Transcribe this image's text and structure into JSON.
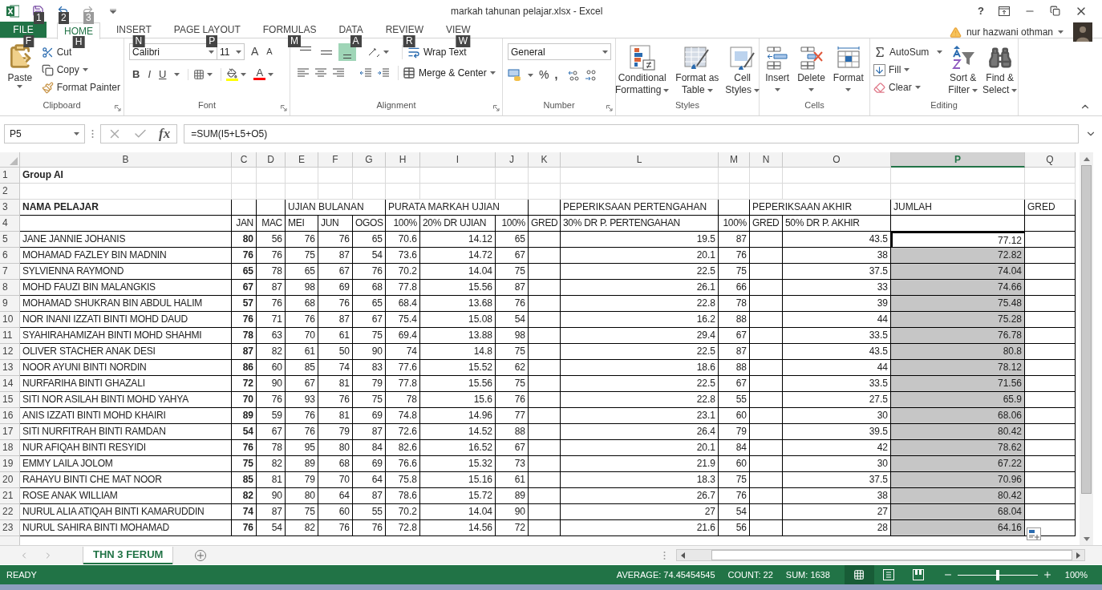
{
  "window": {
    "title": "markah tahunan pelajar.xlsx - Excel",
    "help": "?"
  },
  "quick_access": [
    {
      "kind": "save",
      "keytip": "1",
      "disabled": false
    },
    {
      "kind": "undo",
      "keytip": "2",
      "disabled": false
    },
    {
      "kind": "redo",
      "keytip": "3",
      "disabled": true
    }
  ],
  "tabs": [
    {
      "label": "FILE",
      "keytip": "F",
      "kind": "file",
      "selected": false
    },
    {
      "label": "HOME",
      "keytip": "H",
      "kind": "tab",
      "selected": true
    },
    {
      "label": "INSERT",
      "keytip": "N",
      "kind": "tab",
      "selected": false
    },
    {
      "label": "PAGE LAYOUT",
      "keytip": "P",
      "kind": "tab",
      "selected": false
    },
    {
      "label": "FORMULAS",
      "keytip": "M",
      "kind": "tab",
      "selected": false
    },
    {
      "label": "DATA",
      "keytip": "A",
      "kind": "tab",
      "selected": false
    },
    {
      "label": "REVIEW",
      "keytip": "R",
      "kind": "tab",
      "selected": false
    },
    {
      "label": "VIEW",
      "keytip": "W",
      "kind": "tab",
      "selected": false
    }
  ],
  "account": {
    "name": "nur hazwani othman"
  },
  "ribbon": {
    "clipboard": {
      "label": "Clipboard",
      "paste": "Paste",
      "cut": "Cut",
      "copy": "Copy",
      "format_painter": "Format Painter"
    },
    "font": {
      "label": "Font",
      "font_name": "Calibri",
      "font_size": "11",
      "grow": "A",
      "shrink": "A",
      "bold": "B",
      "italic": "I",
      "underline": "U",
      "font_color": "A"
    },
    "alignment": {
      "label": "Alignment",
      "vertical": [
        {
          "kind": "top",
          "selected": false
        },
        {
          "kind": "middle",
          "selected": false
        },
        {
          "kind": "bottom",
          "selected": true
        }
      ],
      "wrap_text": "Wrap Text",
      "merge_center": "Merge & Center"
    },
    "number": {
      "label": "Number",
      "format": "General",
      "percent": "%",
      "comma": ","
    },
    "styles": {
      "label": "Styles",
      "buttons": [
        {
          "kind": "conditional",
          "lines": [
            "Conditional",
            "Formatting"
          ]
        },
        {
          "kind": "table",
          "lines": [
            "Format as",
            "Table"
          ]
        },
        {
          "kind": "cell",
          "lines": [
            "Cell",
            "Styles"
          ]
        }
      ]
    },
    "cells": {
      "label": "Cells",
      "buttons": [
        {
          "kind": "insert",
          "label": "Insert"
        },
        {
          "kind": "delete",
          "label": "Delete"
        },
        {
          "kind": "format",
          "label": "Format"
        }
      ]
    },
    "editing": {
      "label": "Editing",
      "autosum": "AutoSum",
      "fill": "Fill",
      "clear": "Clear",
      "sort": [
        "Sort &",
        "Filter"
      ],
      "find": [
        "Find &",
        "Select"
      ]
    }
  },
  "formula_bar": {
    "name_box": "P5",
    "fx": "fx",
    "formula": "=SUM(I5+L5+O5)"
  },
  "sheet": {
    "columns": [
      {
        "letter": "B",
        "selected": false
      },
      {
        "letter": "C",
        "selected": false
      },
      {
        "letter": "D",
        "selected": false
      },
      {
        "letter": "E",
        "selected": false
      },
      {
        "letter": "F",
        "selected": false
      },
      {
        "letter": "G",
        "selected": false
      },
      {
        "letter": "H",
        "selected": false
      },
      {
        "letter": "I",
        "selected": false
      },
      {
        "letter": "J",
        "selected": false
      },
      {
        "letter": "K",
        "selected": false
      },
      {
        "letter": "L",
        "selected": false
      },
      {
        "letter": "M",
        "selected": false
      },
      {
        "letter": "N",
        "selected": false
      },
      {
        "letter": "O",
        "selected": false
      },
      {
        "letter": "P",
        "selected": true
      },
      {
        "letter": "Q",
        "selected": false
      }
    ],
    "title_row": {
      "number": "1",
      "text": "Group AI"
    },
    "blank_row": {
      "number": "2"
    },
    "header_row": {
      "number": "3",
      "name": "NAMA PELAJAR",
      "ujian_bulanan": "UJIAN BULANAN",
      "purata": "PURATA MARKAH UJIAN",
      "pertengahan": "PEPERIKSAAN PERTENGAHAN",
      "akhir": "PEPERIKSAAN AKHIR",
      "jumlah": "JUMLAH",
      "gred": "GRED"
    },
    "subheader_row": {
      "number": "4",
      "cells": [
        "JAN",
        "MAC",
        "MEI",
        "JUN",
        "OGOS",
        "100%",
        "20% DR UJIAN",
        "100%",
        "GRED",
        "30% DR P. PERTENGAHAN",
        "100%",
        "GRED",
        "50% DR P. AKHIR"
      ]
    },
    "rows": [
      {
        "number": "5",
        "name": "JANE JANNIE JOHANIS",
        "jan": "80",
        "mac": "56",
        "mei": "76",
        "jun": "76",
        "ogos": "65",
        "purata": "70.6",
        "ujian_20": "14.12",
        "pertengahan_100": "65",
        "pertengahan_30": "19.5",
        "akhir_100": "87",
        "akhir_50": "43.5",
        "jumlah": "77.12",
        "selected": false,
        "active": true
      },
      {
        "number": "6",
        "name": "MOHAMAD FAZLEY BIN MADNIN",
        "jan": "76",
        "mac": "76",
        "mei": "75",
        "jun": "87",
        "ogos": "54",
        "purata": "73.6",
        "ujian_20": "14.72",
        "pertengahan_100": "67",
        "pertengahan_30": "20.1",
        "akhir_100": "76",
        "akhir_50": "38",
        "jumlah": "72.82",
        "selected": true,
        "active": false
      },
      {
        "number": "7",
        "name": "SYLVIENNA RAYMOND",
        "jan": "65",
        "mac": "78",
        "mei": "65",
        "jun": "67",
        "ogos": "76",
        "purata": "70.2",
        "ujian_20": "14.04",
        "pertengahan_100": "75",
        "pertengahan_30": "22.5",
        "akhir_100": "75",
        "akhir_50": "37.5",
        "jumlah": "74.04",
        "selected": true,
        "active": false
      },
      {
        "number": "8",
        "name": "MOHD FAUZI BIN MALANGKIS",
        "jan": "67",
        "mac": "87",
        "mei": "98",
        "jun": "69",
        "ogos": "68",
        "purata": "77.8",
        "ujian_20": "15.56",
        "pertengahan_100": "87",
        "pertengahan_30": "26.1",
        "akhir_100": "66",
        "akhir_50": "33",
        "jumlah": "74.66",
        "selected": true,
        "active": false
      },
      {
        "number": "9",
        "name": "MOHAMAD SHUKRAN BIN ABDUL HALIM",
        "jan": "57",
        "mac": "76",
        "mei": "68",
        "jun": "76",
        "ogos": "65",
        "purata": "68.4",
        "ujian_20": "13.68",
        "pertengahan_100": "76",
        "pertengahan_30": "22.8",
        "akhir_100": "78",
        "akhir_50": "39",
        "jumlah": "75.48",
        "selected": true,
        "active": false
      },
      {
        "number": "10",
        "name": "NOR INANI IZZATI BINTI MOHD DAUD",
        "jan": "76",
        "mac": "71",
        "mei": "76",
        "jun": "87",
        "ogos": "67",
        "purata": "75.4",
        "ujian_20": "15.08",
        "pertengahan_100": "54",
        "pertengahan_30": "16.2",
        "akhir_100": "88",
        "akhir_50": "44",
        "jumlah": "75.28",
        "selected": true,
        "active": false
      },
      {
        "number": "11",
        "name": "SYAHIRAHAMIZAH BINTI MOHD SHAHMI",
        "jan": "78",
        "mac": "63",
        "mei": "70",
        "jun": "61",
        "ogos": "75",
        "purata": "69.4",
        "ujian_20": "13.88",
        "pertengahan_100": "98",
        "pertengahan_30": "29.4",
        "akhir_100": "67",
        "akhir_50": "33.5",
        "jumlah": "76.78",
        "selected": true,
        "active": false
      },
      {
        "number": "12",
        "name": "OLIVER STACHER ANAK DESI",
        "jan": "87",
        "mac": "82",
        "mei": "61",
        "jun": "50",
        "ogos": "90",
        "purata": "74",
        "ujian_20": "14.8",
        "pertengahan_100": "75",
        "pertengahan_30": "22.5",
        "akhir_100": "87",
        "akhir_50": "43.5",
        "jumlah": "80.8",
        "selected": true,
        "active": false
      },
      {
        "number": "13",
        "name": "NOOR AYUNI BINTI NORDIN",
        "jan": "86",
        "mac": "60",
        "mei": "85",
        "jun": "74",
        "ogos": "83",
        "purata": "77.6",
        "ujian_20": "15.52",
        "pertengahan_100": "62",
        "pertengahan_30": "18.6",
        "akhir_100": "88",
        "akhir_50": "44",
        "jumlah": "78.12",
        "selected": true,
        "active": false
      },
      {
        "number": "14",
        "name": "NURFARIHA BINTI GHAZALI",
        "jan": "72",
        "mac": "90",
        "mei": "67",
        "jun": "81",
        "ogos": "79",
        "purata": "77.8",
        "ujian_20": "15.56",
        "pertengahan_100": "75",
        "pertengahan_30": "22.5",
        "akhir_100": "67",
        "akhir_50": "33.5",
        "jumlah": "71.56",
        "selected": true,
        "active": false
      },
      {
        "number": "15",
        "name": "SITI NOR ASILAH BINTI MOHD YAHYA",
        "jan": "70",
        "mac": "76",
        "mei": "93",
        "jun": "76",
        "ogos": "75",
        "purata": "78",
        "ujian_20": "15.6",
        "pertengahan_100": "76",
        "pertengahan_30": "22.8",
        "akhir_100": "55",
        "akhir_50": "27.5",
        "jumlah": "65.9",
        "selected": true,
        "active": false
      },
      {
        "number": "16",
        "name": "ANIS IZZATI BINTI MOHD KHAIRI",
        "jan": "89",
        "mac": "59",
        "mei": "76",
        "jun": "81",
        "ogos": "69",
        "purata": "74.8",
        "ujian_20": "14.96",
        "pertengahan_100": "77",
        "pertengahan_30": "23.1",
        "akhir_100": "60",
        "akhir_50": "30",
        "jumlah": "68.06",
        "selected": true,
        "active": false
      },
      {
        "number": "17",
        "name": "SITI NURFITRAH BINTI RAMDAN",
        "jan": "54",
        "mac": "67",
        "mei": "76",
        "jun": "79",
        "ogos": "87",
        "purata": "72.6",
        "ujian_20": "14.52",
        "pertengahan_100": "88",
        "pertengahan_30": "26.4",
        "akhir_100": "79",
        "akhir_50": "39.5",
        "jumlah": "80.42",
        "selected": true,
        "active": false
      },
      {
        "number": "18",
        "name": "NUR AFIQAH BINTI RESYIDI",
        "jan": "76",
        "mac": "78",
        "mei": "95",
        "jun": "80",
        "ogos": "84",
        "purata": "82.6",
        "ujian_20": "16.52",
        "pertengahan_100": "67",
        "pertengahan_30": "20.1",
        "akhir_100": "84",
        "akhir_50": "42",
        "jumlah": "78.62",
        "selected": true,
        "active": false
      },
      {
        "number": "19",
        "name": "EMMY LAILA JOLOM",
        "jan": "75",
        "mac": "82",
        "mei": "89",
        "jun": "68",
        "ogos": "69",
        "purata": "76.6",
        "ujian_20": "15.32",
        "pertengahan_100": "73",
        "pertengahan_30": "21.9",
        "akhir_100": "60",
        "akhir_50": "30",
        "jumlah": "67.22",
        "selected": true,
        "active": false
      },
      {
        "number": "20",
        "name": "RAHAYU BINTI CHE MAT NOOR",
        "jan": "85",
        "mac": "81",
        "mei": "79",
        "jun": "70",
        "ogos": "64",
        "purata": "75.8",
        "ujian_20": "15.16",
        "pertengahan_100": "61",
        "pertengahan_30": "18.3",
        "akhir_100": "75",
        "akhir_50": "37.5",
        "jumlah": "70.96",
        "selected": true,
        "active": false
      },
      {
        "number": "21",
        "name": "ROSE ANAK WILLIAM",
        "jan": "82",
        "mac": "90",
        "mei": "80",
        "jun": "64",
        "ogos": "87",
        "purata": "78.6",
        "ujian_20": "15.72",
        "pertengahan_100": "89",
        "pertengahan_30": "26.7",
        "akhir_100": "76",
        "akhir_50": "38",
        "jumlah": "80.42",
        "selected": true,
        "active": false
      },
      {
        "number": "22",
        "name": "NURUL ALIA ATIQAH BINTI KAMARUDDIN",
        "jan": "74",
        "mac": "87",
        "mei": "75",
        "jun": "60",
        "ogos": "55",
        "purata": "70.2",
        "ujian_20": "14.04",
        "pertengahan_100": "90",
        "pertengahan_30": "27",
        "akhir_100": "54",
        "akhir_50": "27",
        "jumlah": "68.04",
        "selected": true,
        "active": false
      },
      {
        "number": "23",
        "name": "NURUL SAHIRA BINTI MOHAMAD",
        "jan": "76",
        "mac": "54",
        "mei": "82",
        "jun": "76",
        "ogos": "76",
        "purata": "72.8",
        "ujian_20": "14.56",
        "pertengahan_100": "72",
        "pertengahan_30": "21.6",
        "akhir_100": "56",
        "akhir_50": "28",
        "jumlah": "64.16",
        "selected": true,
        "active": false
      }
    ]
  },
  "sheet_tabs": [
    {
      "label": "THN 3 FERUM",
      "selected": true
    }
  ],
  "status_bar": {
    "mode": "READY",
    "average": "AVERAGE: 74.45454545",
    "count": "COUNT: 22",
    "sum": "SUM: 1638",
    "views": [
      {
        "kind": "normal",
        "selected": true
      },
      {
        "kind": "page_layout",
        "selected": false
      },
      {
        "kind": "page_break",
        "selected": false
      }
    ],
    "zoom": {
      "level": 0.5,
      "reading": "100%"
    }
  }
}
